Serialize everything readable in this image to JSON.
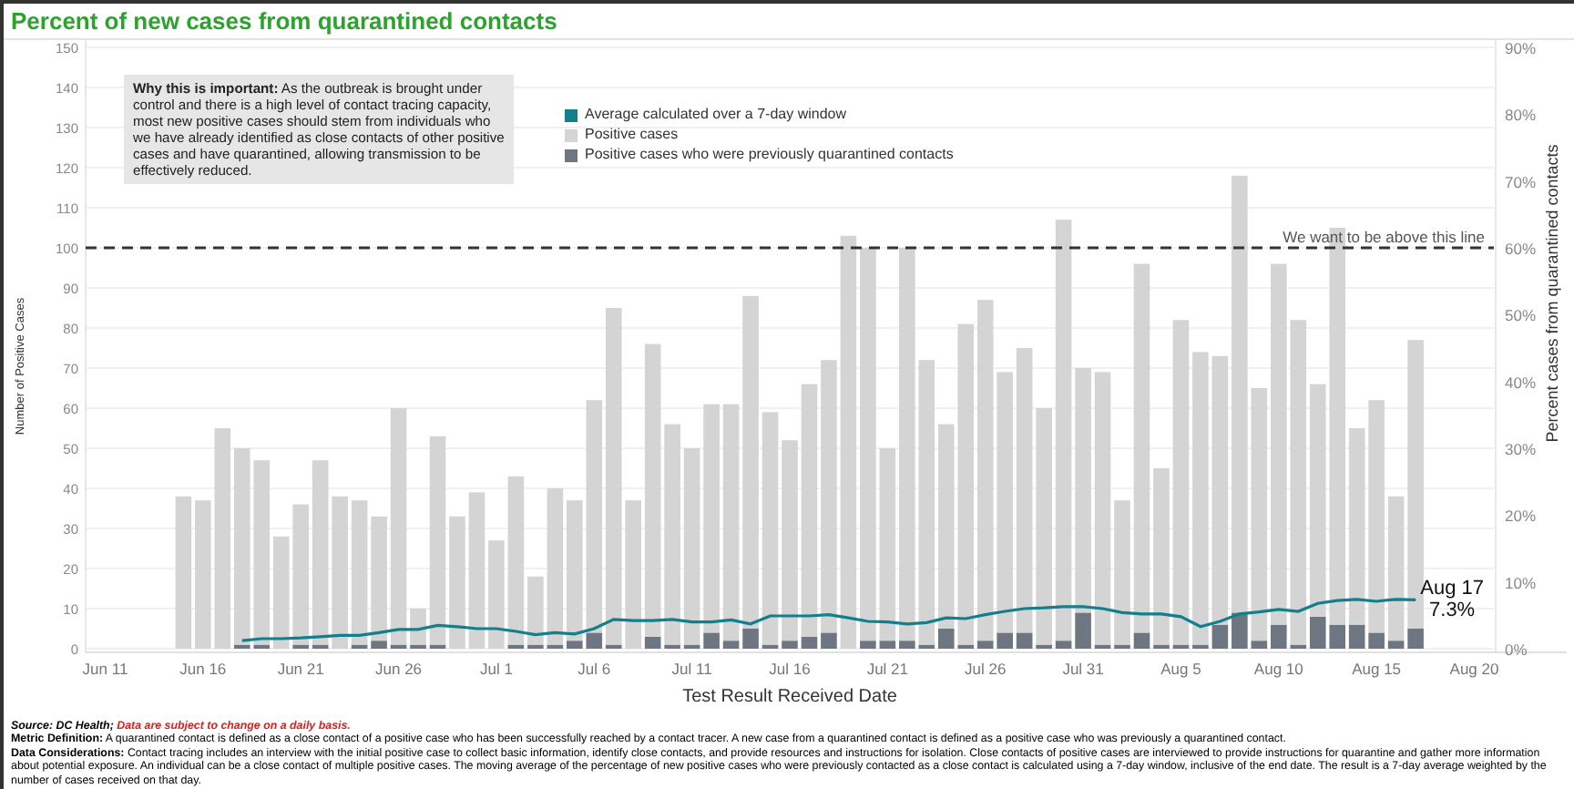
{
  "title": "Percent of new cases from quarantined contacts",
  "cases": {
    "chart_data": {
      "type": "bar",
      "stacked": true,
      "xlabel": "Test Result Received Date",
      "ylabel": "Number of Positive Cases",
      "categories": [
        "Jun 11",
        null,
        null,
        null,
        null,
        "Jun 16",
        null,
        null,
        null,
        null,
        "Jun 21",
        null,
        null,
        null,
        null,
        "Jun 26",
        null,
        null,
        null,
        null,
        "Jul 1",
        null,
        null,
        null,
        null,
        "Jul 6",
        null,
        null,
        null,
        null,
        "Jul 11",
        null,
        null,
        null,
        null,
        "Jul 16",
        null,
        null,
        null,
        null,
        "Jul 21",
        null,
        null,
        null,
        null,
        "Jul 26",
        null,
        null,
        null,
        null,
        "Jul 31",
        null,
        null,
        null,
        null,
        "Aug 5",
        null,
        null,
        null,
        null,
        "Aug 10",
        null,
        null,
        null,
        null,
        "Aug 15",
        null,
        null,
        null,
        null,
        "Aug 20"
      ],
      "ylim": [
        0,
        150
      ],
      "yticks": [
        0,
        10,
        20,
        30,
        40,
        50,
        60,
        70,
        80,
        90,
        100,
        110,
        120,
        130,
        140,
        150
      ],
      "series": [
        {
          "name": "Positive cases",
          "color": "#d4d4d4",
          "values": [
            null,
            null,
            null,
            null,
            38,
            37,
            55,
            49,
            46,
            28,
            35,
            46,
            38,
            36,
            31,
            59,
            9,
            52,
            33,
            39,
            27,
            42,
            17,
            39,
            35,
            58,
            84,
            37,
            73,
            55,
            49,
            57,
            59,
            83,
            58,
            50,
            63,
            68,
            103,
            98,
            48,
            98,
            71,
            51,
            80,
            85,
            65,
            71,
            59,
            105,
            61,
            68,
            36,
            92,
            44,
            81,
            73,
            67,
            109,
            63,
            90,
            81,
            58,
            99,
            49,
            58,
            36,
            72,
            null,
            null,
            null
          ]
        },
        {
          "name": "Positive cases who were previously quarantined contacts",
          "color": "#6e7682",
          "values": [
            null,
            null,
            null,
            null,
            0,
            0,
            0,
            1,
            1,
            0,
            1,
            1,
            0,
            1,
            2,
            1,
            1,
            1,
            0,
            0,
            0,
            1,
            1,
            1,
            2,
            4,
            1,
            0,
            3,
            1,
            1,
            4,
            2,
            5,
            1,
            2,
            3,
            4,
            0,
            2,
            2,
            2,
            1,
            5,
            1,
            2,
            4,
            4,
            1,
            2,
            9,
            1,
            1,
            4,
            1,
            1,
            1,
            6,
            9,
            2,
            6,
            1,
            8,
            6,
            6,
            4,
            2,
            5,
            null,
            null,
            null
          ]
        }
      ],
      "grid": true,
      "ref_lines": [
        {
          "axis": "y",
          "value": 100,
          "label": "We want to be above this line"
        }
      ]
    }
  },
  "trend": {
    "chart_data": {
      "type": "line",
      "ylabel": "Percent cases from quarantined contacts",
      "categories": [
        null,
        null,
        null,
        null,
        null,
        null,
        null,
        null,
        null,
        null,
        null,
        null,
        null,
        null,
        null,
        null,
        null,
        null,
        null,
        null,
        null,
        null,
        null,
        null,
        null,
        null,
        null,
        null,
        null,
        null,
        null,
        null,
        null,
        null,
        null,
        null,
        null,
        null,
        null,
        null,
        null,
        null,
        null,
        null,
        null,
        null,
        null,
        null,
        null,
        null,
        null,
        null,
        null,
        null,
        null,
        null,
        null,
        null,
        null,
        null,
        null,
        null,
        null,
        null,
        null,
        null,
        null,
        null,
        null,
        null,
        null
      ],
      "ylim": [
        0,
        90
      ],
      "yticks": [
        {
          "value": 0,
          "label": "0%"
        },
        {
          "value": 10,
          "label": "10%"
        },
        {
          "value": 20,
          "label": "20%"
        },
        {
          "value": 30,
          "label": "30%"
        },
        {
          "value": 40,
          "label": "40%"
        },
        {
          "value": 50,
          "label": "50%"
        },
        {
          "value": 60,
          "label": "60%"
        },
        {
          "value": 70,
          "label": "70%"
        },
        {
          "value": 80,
          "label": "80%"
        },
        {
          "value": 90,
          "label": "90%"
        }
      ],
      "series": [
        {
          "name": "Average calculated over a 7-day window",
          "color": "#117f8c",
          "values": [
            null,
            null,
            null,
            null,
            null,
            null,
            null,
            1.2,
            1.5,
            1.5,
            1.6,
            1.8,
            2.0,
            2.0,
            2.4,
            2.9,
            2.9,
            3.5,
            3.3,
            3.0,
            3.0,
            2.6,
            2.1,
            2.4,
            2.2,
            3.0,
            4.4,
            4.2,
            4.2,
            4.4,
            4.0,
            4.0,
            4.3,
            3.7,
            4.9,
            4.9,
            4.9,
            5.1,
            4.6,
            4.1,
            4.0,
            3.7,
            3.9,
            4.6,
            4.5,
            5.1,
            5.6,
            6.0,
            6.1,
            6.3,
            6.3,
            6.0,
            5.4,
            5.2,
            5.2,
            4.8,
            3.3,
            4.1,
            5.2,
            5.5,
            5.9,
            5.6,
            6.8,
            7.2,
            7.4,
            7.1,
            7.4,
            7.3,
            null,
            null,
            null
          ]
        }
      ],
      "annotations": [
        "Aug 17",
        "7.3%"
      ]
    }
  },
  "note": "**Why this is important:** As the outbreak is brought under control and there is a high level of contact tracing capacity, most new positive cases should stem from individuals who we have already identified as close contacts of other positive cases and have quarantined, allowing transmission to be effectively reduced.",
  "source": {
    "label": "Source: DC Health;",
    "text": "Data are subject to change on a daily basis."
  },
  "footnotes": [
    "**Metric Definition:** A quarantined contact is defined as a close contact of a positive case who has been successfully reached by a contact tracer. A new case from a quarantined contact is defined as a positive case who was previously a quarantined contact.",
    "**Data Considerations:** Contact tracing includes an interview with the initial positive case to collect basic information, identify close contacts, and provide resources and instructions for isolation. Close contacts of positive cases are interviewed to provide instructions for quarantine and gather more information about potential exposure. An individual can be a close contact of multiple positive cases. The moving average of the percentage of new positive cases who were previously contacted as a close contact is calculated using a 7-day window, inclusive of the end date. The result is a 7-day average weighted by the number of cases received on that day."
  ]
}
